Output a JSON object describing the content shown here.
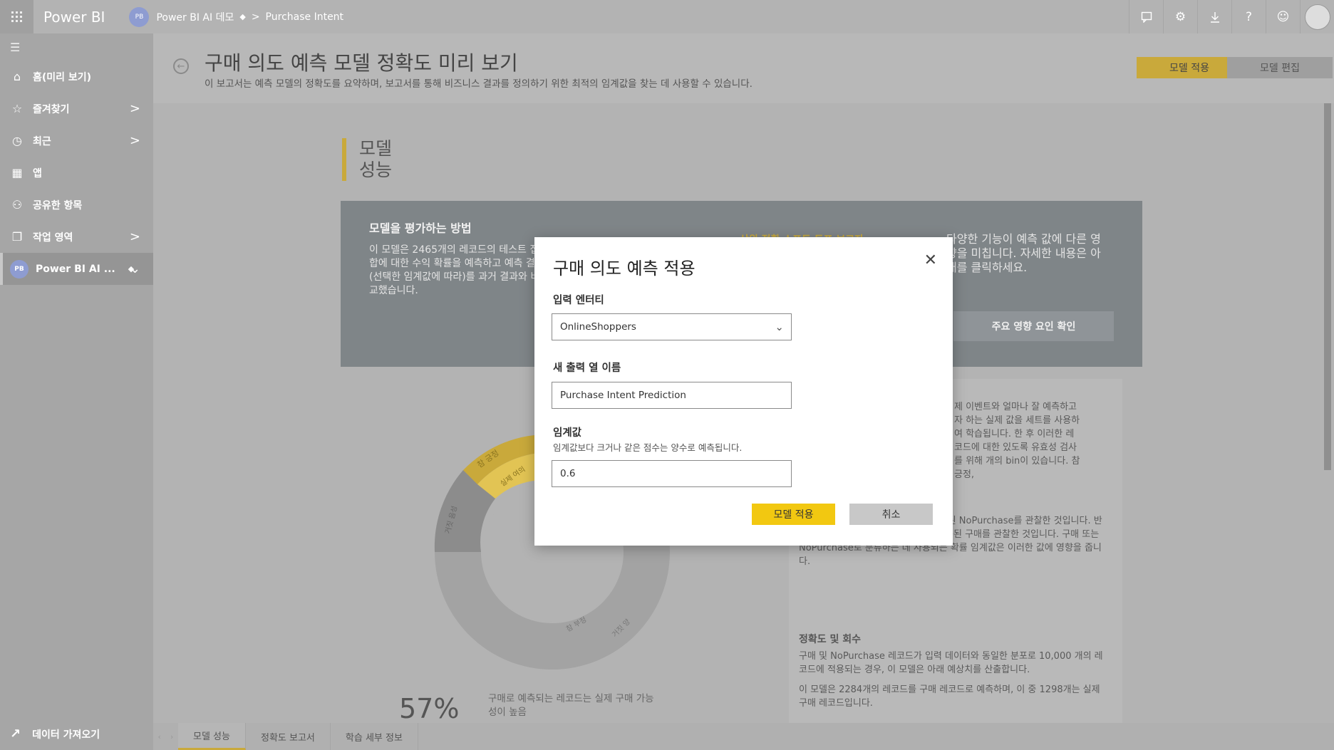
{
  "app": {
    "brand": "Power BI"
  },
  "breadcrumb": {
    "avatar": "PB",
    "workspace": "Power BI AI 데모",
    "separator": ">",
    "report": "Purchase Intent"
  },
  "topbar": {
    "icons": [
      "comment-icon",
      "gear-icon",
      "download-icon",
      "help-icon",
      "smile-icon",
      "user-avatar"
    ]
  },
  "nav": {
    "items": [
      {
        "label": "홈(미리 보기)",
        "icon": "home-icon"
      },
      {
        "label": "즐겨찾기",
        "icon": "star-icon",
        "chevron": ">"
      },
      {
        "label": "최근",
        "icon": "clock-icon",
        "chevron": ">"
      },
      {
        "label": "앱",
        "icon": "apps-icon"
      },
      {
        "label": "공유한 항목",
        "icon": "shared-icon"
      },
      {
        "label": "작업 영역",
        "icon": "workspace-icon",
        "chevron": ">"
      }
    ],
    "workspace": {
      "avatar": "PB",
      "label": "Power BI AI ...",
      "chevron": "⌄"
    },
    "get_data": "데이터 가져오기"
  },
  "header": {
    "title": "구매 의도 예측 모델 정확도 미리 보기",
    "subtitle": "이 보고서는 예측 모델의 정확도를 요약하며, 보고서를 통해 비즈니스 결과를 정의하기 위한 최적의 임계값을 찾는 데 사용할 수 있습니다.",
    "apply_button": "모델 적용",
    "edit_button": "모델 편집"
  },
  "section": {
    "title_line1": "모델",
    "title_line2": "성능"
  },
  "eval": {
    "heading": "모델을 평가하는 방법",
    "text": "이 모델은 2465개의 레코드의 테스트 집합에 대한 수익 확률을 예측하고 예측 결과(선택한 임계값에 따라)를 과거 결과와 비교했습니다.",
    "link": "상위 정확 스프트 트프 보고자",
    "right_text": "다양한 기능이 예측 값에 다른 영향을 미칩니다. 자세한 내용은 아래를 클릭하세요.",
    "button": "주요 영향 요인 확인"
  },
  "donut": {
    "labels": [
      "참 긍정",
      "실제 여의",
      "거짓 음성",
      "참 부정",
      "거짓 양"
    ]
  },
  "stat": {
    "percent": "57%",
    "desc": "구매로 예측되는 레코드는 실제 구매 가능성이 높음"
  },
  "right_panel": {
    "p1": "제 이벤트와 얼마나 잘 예측하고자 하는 실제 값을 세트를 사용하여 학습됩니다. 한 후 이러한 레코드에 대한 있도록 유효성 검사를 위해 개의 bin이 있습니다. 참 긍정,",
    "p2": "NoPurchase 이벤트를 올바르게 예측된 NoPurchase를 관찰한 것입니다. 반대로, 거짓 부정은 NoPurchase로 예측된 구매를 관찰한 것입니다. 구매 또는 NoPurchase로 분류하는 데 사용되는 확률 임계값은 이러한 값에 영향을 줍니다.",
    "heading": "정확도 및 회수",
    "p3": "구매 및 NoPurchase 레코드가 입력 데이터와 동일한 분포로 10,000 개의 레코드에 적용되는 경우, 이 모델은 아래 예상치를 산출합니다.",
    "p4": "이 모델은 2284개의 레코드를 구매 레코드로 예측하며, 이 중 1298개는 실제 구매 레코드입니다."
  },
  "tabs": [
    {
      "label": "모델 성능",
      "active": true
    },
    {
      "label": "정확도 보고서",
      "active": false
    },
    {
      "label": "학습 세부 정보",
      "active": false
    }
  ],
  "modal": {
    "title": "구매 의도 예측 적용",
    "close": "✕",
    "entity_label": "입력 엔터티",
    "entity_value": "OnlineShoppers",
    "column_label": "새 출력 열 이름",
    "column_value": "Purchase Intent Prediction",
    "threshold_label": "임계값",
    "threshold_hint": "임계값보다 크거나 같은 점수는 양수로 예측됩니다.",
    "threshold_value": "0.6",
    "apply": "모델 적용",
    "cancel": "취소"
  },
  "colors": {
    "accent": "#f2c811",
    "overlay_gold": "#c9a93b",
    "topbar": "#b3b3b3"
  }
}
